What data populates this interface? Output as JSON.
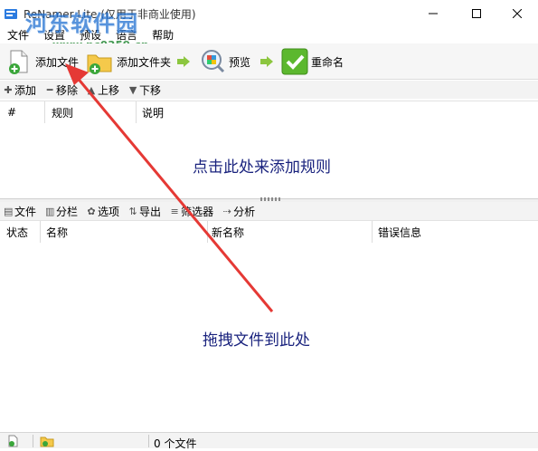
{
  "window": {
    "title": "ReNamer Lite (仅用于非商业使用)",
    "minimize_icon": "minimize-icon",
    "maximize_icon": "maximize-icon",
    "close_icon": "close-icon"
  },
  "watermark": {
    "text": "河东软件园",
    "url": "www.pc0359.cn"
  },
  "menu": [
    "文件",
    "设置",
    "预设",
    "语言",
    "帮助"
  ],
  "toolbar": {
    "add_files": "添加文件",
    "add_folder": "添加文件夹",
    "preview": "预览",
    "rename": "重命名"
  },
  "rules_bar": {
    "add": "添加",
    "remove": "移除",
    "up": "上移",
    "down": "下移"
  },
  "rules_table": {
    "columns": [
      "#",
      "规则",
      "说明"
    ],
    "empty_hint": "点击此处来添加规则"
  },
  "files_bar": {
    "file": "文件",
    "columns": "分栏",
    "options": "选项",
    "export": "导出",
    "filter": "筛选器",
    "analyze": "分析"
  },
  "files_table": {
    "columns": [
      "状态",
      "名称",
      "新名称",
      "错误信息"
    ],
    "empty_hint": "拖拽文件到此处"
  },
  "status": {
    "file_count": "0 个文件"
  },
  "colors": {
    "hint": "#1a237e",
    "annotation_arrow": "#e53935",
    "watermark": "#1f6fd1"
  }
}
